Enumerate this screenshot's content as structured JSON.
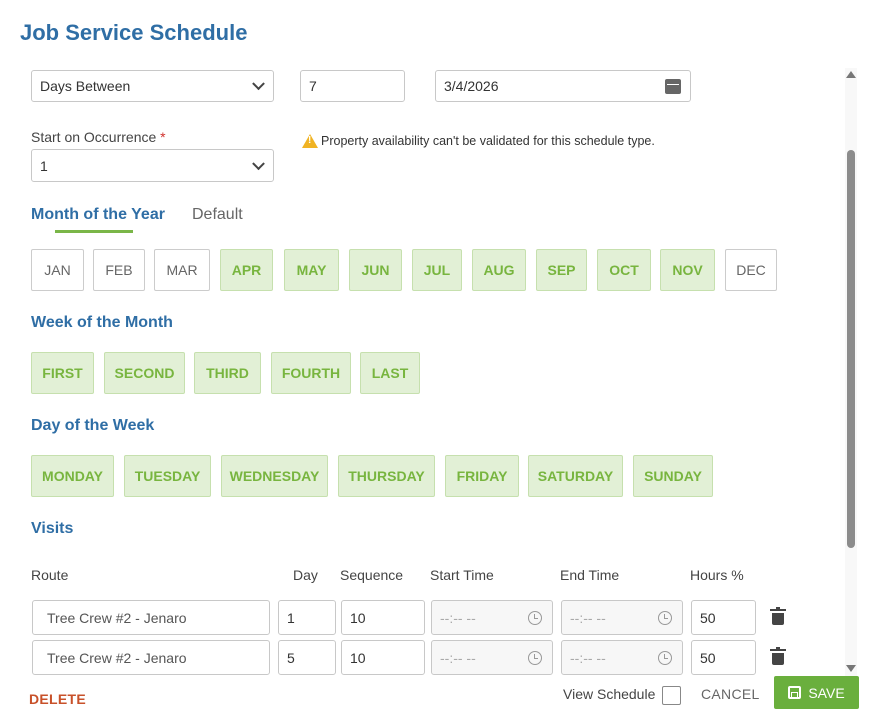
{
  "title": "Job Service Schedule",
  "schedule": {
    "type_value": "Days Between",
    "interval_value": "7",
    "start_date_value": "3/4/2026",
    "occurrence_label": "Start on Occurrence",
    "occurrence_required_mark": "*",
    "occurrence_value": "1",
    "warning_text": "Property availability can't be validated for this schedule type."
  },
  "tabs": [
    {
      "label": "Month of the Year",
      "active": true
    },
    {
      "label": "Default",
      "active": false
    }
  ],
  "months": [
    {
      "label": "JAN",
      "selected": false
    },
    {
      "label": "FEB",
      "selected": false
    },
    {
      "label": "MAR",
      "selected": false
    },
    {
      "label": "APR",
      "selected": true
    },
    {
      "label": "MAY",
      "selected": true
    },
    {
      "label": "JUN",
      "selected": true
    },
    {
      "label": "JUL",
      "selected": true
    },
    {
      "label": "AUG",
      "selected": true
    },
    {
      "label": "SEP",
      "selected": true
    },
    {
      "label": "OCT",
      "selected": true
    },
    {
      "label": "NOV",
      "selected": true
    },
    {
      "label": "DEC",
      "selected": false
    }
  ],
  "week_of_month": {
    "heading": "Week of the Month",
    "items": [
      {
        "label": "FIRST",
        "selected": true
      },
      {
        "label": "SECOND",
        "selected": true
      },
      {
        "label": "THIRD",
        "selected": true
      },
      {
        "label": "FOURTH",
        "selected": true
      },
      {
        "label": "LAST",
        "selected": true
      }
    ]
  },
  "day_of_week": {
    "heading": "Day of the Week",
    "items": [
      {
        "label": "MONDAY",
        "selected": true
      },
      {
        "label": "TUESDAY",
        "selected": true
      },
      {
        "label": "WEDNESDAY",
        "selected": true
      },
      {
        "label": "THURSDAY",
        "selected": true
      },
      {
        "label": "FRIDAY",
        "selected": true
      },
      {
        "label": "SATURDAY",
        "selected": true
      },
      {
        "label": "SUNDAY",
        "selected": true
      }
    ]
  },
  "visits": {
    "heading": "Visits",
    "columns": {
      "route": "Route",
      "day": "Day",
      "sequence": "Sequence",
      "start_time": "Start Time",
      "end_time": "End Time",
      "hours": "Hours %"
    },
    "rows": [
      {
        "route": "Tree Crew #2 - Jenaro",
        "day": "1",
        "sequence": "10",
        "start_time": "--:-- --",
        "end_time": "--:-- --",
        "hours": "50"
      },
      {
        "route": "Tree Crew #2 - Jenaro",
        "day": "5",
        "sequence": "10",
        "start_time": "--:-- --",
        "end_time": "--:-- --",
        "hours": "50"
      }
    ]
  },
  "footer": {
    "delete_label": "DELETE",
    "view_schedule_label": "View Schedule",
    "view_schedule_checked": false,
    "cancel_label": "CANCEL",
    "save_label": "SAVE"
  },
  "colors": {
    "heading_blue": "#2f6ea5",
    "selected_bg": "#e2f0d6",
    "selected_text": "#78b53f",
    "save_green": "#6aaf3d",
    "delete_red": "#c8512a"
  }
}
